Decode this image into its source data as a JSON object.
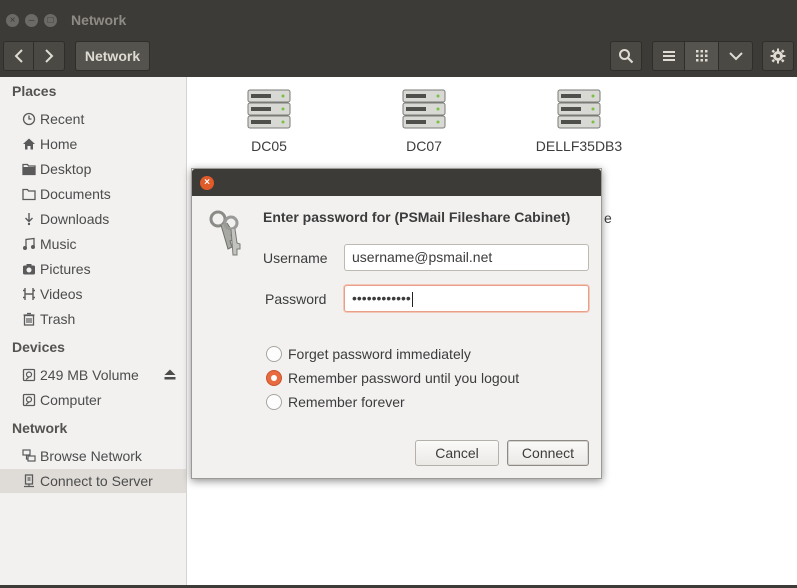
{
  "window": {
    "title": "Network"
  },
  "toolbar": {
    "path_label": "Network"
  },
  "sidebar": {
    "places_header": "Places",
    "places": [
      {
        "label": "Recent",
        "icon": "clock-icon"
      },
      {
        "label": "Home",
        "icon": "home-icon"
      },
      {
        "label": "Desktop",
        "icon": "folder-icon"
      },
      {
        "label": "Documents",
        "icon": "document-icon"
      },
      {
        "label": "Downloads",
        "icon": "download-icon"
      },
      {
        "label": "Music",
        "icon": "music-icon"
      },
      {
        "label": "Pictures",
        "icon": "camera-icon"
      },
      {
        "label": "Videos",
        "icon": "film-icon"
      },
      {
        "label": "Trash",
        "icon": "trash-icon"
      }
    ],
    "devices_header": "Devices",
    "devices": [
      {
        "label": "249 MB Volume",
        "icon": "drive-icon"
      },
      {
        "label": "Computer",
        "icon": "drive-icon"
      }
    ],
    "network_header": "Network",
    "network": [
      {
        "label": "Browse Network",
        "icon": "network-icon"
      },
      {
        "label": "Connect to Server",
        "icon": "server-connect-icon"
      }
    ]
  },
  "content": {
    "servers": [
      "DC05",
      "DC07",
      "DELLF35DB3"
    ],
    "hidden_label_fragment": "e"
  },
  "dialog": {
    "heading": "Enter password for (PSMail Fileshare Cabinet)",
    "username_label": "Username",
    "username_value": "username@psmail.net",
    "password_label": "Password",
    "password_value": "••••••••••••",
    "options": [
      {
        "label": "Forget password immediately",
        "checked": false
      },
      {
        "label": "Remember password until you logout",
        "checked": true
      },
      {
        "label": "Remember forever",
        "checked": false
      }
    ],
    "cancel_label": "Cancel",
    "connect_label": "Connect"
  },
  "colors": {
    "accent": "#e86a3f",
    "titlebar": "#3c3b37"
  }
}
